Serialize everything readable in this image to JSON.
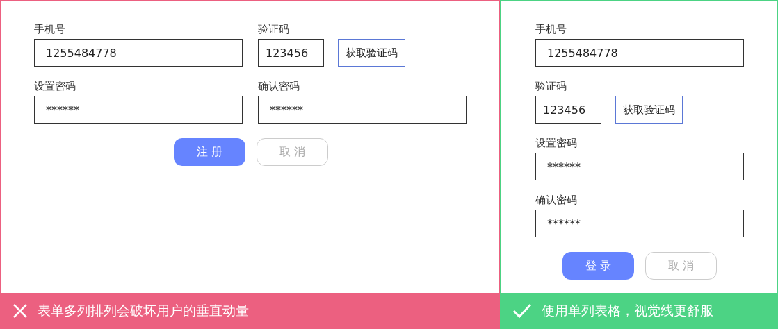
{
  "panels": [
    {
      "kind": "multi_column",
      "color": "#ec6080",
      "fields": [
        {
          "label": "手机号",
          "value": "1255484778"
        },
        {
          "label": "验证码",
          "value": "123456",
          "action": "获取验证码"
        },
        {
          "label": "设置密码",
          "value": "******"
        },
        {
          "label": "确认密码",
          "value": "******"
        }
      ],
      "buttons": [
        {
          "label": "注 册",
          "kind": "primary"
        },
        {
          "label": "取 消",
          "kind": "secondary"
        }
      ],
      "caption": {
        "kind": "bad",
        "text": "表单多列排列会破坏用户的垂直动量"
      }
    },
    {
      "kind": "single_column",
      "color": "#4cd384",
      "fields": [
        {
          "label": "手机号",
          "value": "1255484778"
        },
        {
          "label": "验证码",
          "value": "123456",
          "action": "获取验证码"
        },
        {
          "label": "设置密码",
          "value": "******"
        },
        {
          "label": "确认密码",
          "value": "******"
        }
      ],
      "buttons": [
        {
          "label": "登 录",
          "kind": "primary"
        },
        {
          "label": "取 消",
          "kind": "secondary"
        }
      ],
      "caption": {
        "kind": "good",
        "text": "使用单列表格，视觉线更舒服"
      }
    }
  ]
}
